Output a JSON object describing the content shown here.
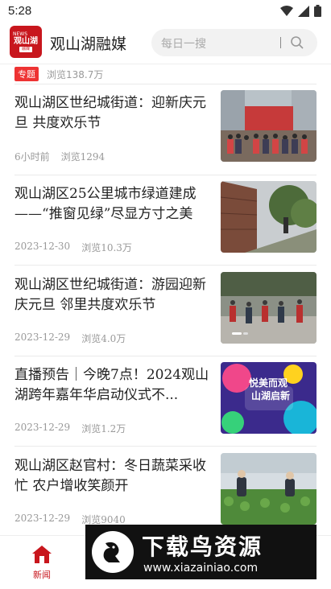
{
  "status_bar": {
    "time": "5:28"
  },
  "header": {
    "logo": {
      "top_text": "NEWS",
      "main_text": "观山湖",
      "sub_text": "融媒"
    },
    "title": "观山湖融媒",
    "search_placeholder": "每日一搜"
  },
  "top_item": {
    "tag": "专题",
    "views": "浏览138.7万"
  },
  "articles": [
    {
      "title": "观山湖区世纪城街道：迎新庆元旦 共度欢乐节",
      "time": "6小时前",
      "views": "浏览1294"
    },
    {
      "title": "观山湖区25公里城市绿道建成——“推窗见绿”尽显方寸之美",
      "time": "2023-12-30",
      "views": "浏览10.3万"
    },
    {
      "title": "观山湖区世纪城街道：游园迎新庆元旦 邻里共度欢乐节",
      "time": "2023-12-29",
      "views": "浏览4.0万"
    },
    {
      "title": "直播预告｜今晚7点！2024观山湖跨年嘉年华启动仪式不...",
      "time": "2023-12-29",
      "views": "浏览1.2万"
    },
    {
      "title": "观山湖区赵官村：冬日蔬菜采收忙 农户增收笑颜开",
      "time": "2023-12-29",
      "views": "浏览9040"
    }
  ],
  "thumb_texts": {
    "banner_line1": "悦美而观",
    "banner_line2": "山湖启新"
  },
  "tab_bar": {
    "news_label": "新闻"
  },
  "watermark": {
    "title": "下载鸟资源",
    "url": "www.xiazainiao.com"
  },
  "colors": {
    "brand_red": "#c8161d",
    "tag_red": "#e33"
  }
}
